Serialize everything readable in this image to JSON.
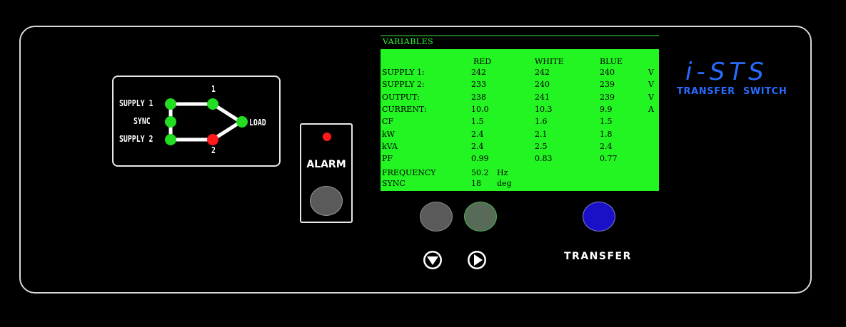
{
  "mimic": {
    "supply1_label": "SUPPLY 1",
    "sync_label": "SYNC",
    "supply2_label": "SUPPLY 2",
    "switch1_label": "1",
    "switch2_label": "2",
    "load_label": "LOAD",
    "indicator_colors": {
      "supply1": "#22dd22",
      "sync": "#22dd22",
      "supply2": "#22dd22",
      "switch1": "#22dd22",
      "switch2": "#ff1a1a",
      "load": "#22dd22"
    }
  },
  "alarm": {
    "label": "ALARM",
    "led_color": "#ff1a1a"
  },
  "lcd": {
    "title": "VARIABLES",
    "headers": [
      "RED",
      "WHITE",
      "BLUE"
    ],
    "rows": [
      {
        "label": "SUPPLY 1:",
        "red": "242",
        "white": "242",
        "blue": "240",
        "unit": "V"
      },
      {
        "label": "SUPPLY 2:",
        "red": "233",
        "white": "240",
        "blue": "239",
        "unit": "V"
      },
      {
        "label": "OUTPUT:",
        "red": "238",
        "white": "241",
        "blue": "239",
        "unit": "V"
      },
      {
        "label": "CURRENT:",
        "red": "10.0",
        "white": "10.3",
        "blue": "9.9",
        "unit": "A"
      },
      {
        "label": "CF",
        "red": "1.5",
        "white": "1.6",
        "blue": "1.5",
        "unit": ""
      },
      {
        "label": "kW",
        "red": "2.4",
        "white": "2.1",
        "blue": "1.8",
        "unit": ""
      },
      {
        "label": "kVA",
        "red": "2.4",
        "white": "2.5",
        "blue": "2.4",
        "unit": ""
      },
      {
        "label": "PF",
        "red": "0.99",
        "white": "0.83",
        "blue": "0.77",
        "unit": ""
      }
    ],
    "frequency": {
      "label": "FREQUENCY",
      "value": "50.2",
      "unit": "Hz"
    },
    "sync": {
      "label": "SYNC",
      "value": "18",
      "unit": "deg"
    }
  },
  "controls": {
    "down_icon": "down-arrow-icon",
    "right_icon": "right-arrow-icon",
    "transfer_label": "TRANSFER"
  },
  "logo": {
    "main": "i-STS",
    "sub": "TRANSFER SWITCH"
  }
}
